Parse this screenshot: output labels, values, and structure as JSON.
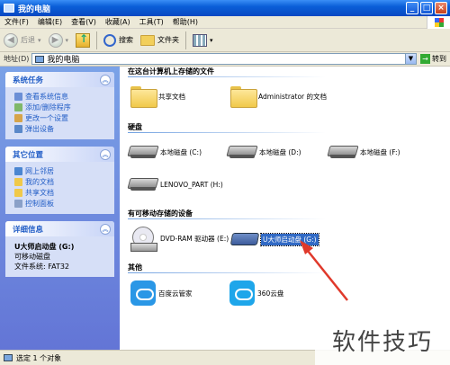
{
  "window": {
    "title": "我的电脑"
  },
  "menu": {
    "items": [
      "文件(F)",
      "编辑(E)",
      "查看(V)",
      "收藏(A)",
      "工具(T)",
      "帮助(H)"
    ]
  },
  "toolbar": {
    "back_label": "后退",
    "search_label": "搜索",
    "folders_label": "文件夹"
  },
  "address": {
    "label": "地址(D)",
    "value": "我的电脑",
    "go_label": "转到"
  },
  "sidebar": {
    "system_tasks": {
      "title": "系统任务",
      "items": [
        "查看系统信息",
        "添加/删除程序",
        "更改一个设置",
        "弹出设备"
      ]
    },
    "other_places": {
      "title": "其它位置",
      "items": [
        "网上邻居",
        "我的文档",
        "共享文档",
        "控制面板"
      ]
    },
    "details": {
      "title": "详细信息",
      "name": "U大师启动盘 (G:)",
      "type": "可移动磁盘",
      "filesystem": "文件系统: FAT32"
    }
  },
  "main": {
    "groups": {
      "stored_files": "在这台计算机上存储的文件",
      "hard_drives": "硬盘",
      "removable": "有可移动存储的设备",
      "others": "其他"
    },
    "folders": [
      "共享文档",
      "Administrator 的文档"
    ],
    "drives": [
      "本地磁盘 (C:)",
      "本地磁盘 (D:)",
      "本地磁盘 (F:)",
      "LENOVO_PART (H:)"
    ],
    "removable_items": [
      "DVD-RAM 驱动器 (E:)",
      "U大师启动盘 (G:)"
    ],
    "other_items": [
      "百度云管家",
      "360云盘"
    ]
  },
  "status": {
    "text": "选定 1 个对象"
  },
  "watermark": {
    "text": "软件技巧"
  },
  "colors": {
    "title_blue": "#0a5fd8",
    "task_blue": "#215dc6",
    "selection": "#316ac5",
    "arrow": "#e0392b"
  }
}
